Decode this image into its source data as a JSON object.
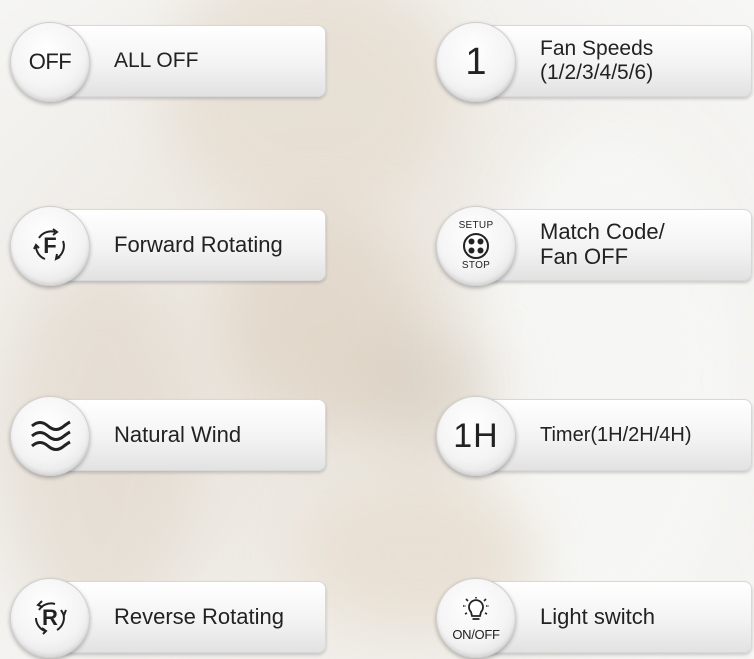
{
  "buttons": {
    "all_off": {
      "icon_text": "OFF",
      "label": "ALL OFF"
    },
    "fan_speed": {
      "icon_text": "1",
      "label": "Fan Speeds\n(1/2/3/4/5/6)"
    },
    "forward": {
      "icon_text": "F",
      "label": "Forward Rotating"
    },
    "match": {
      "icon_top": "SETUP",
      "icon_bottom": "STOP",
      "label": "Match Code/\nFan OFF"
    },
    "wind": {
      "icon": "wave-icon",
      "label": "Natural Wind"
    },
    "timer": {
      "icon_text": "1H",
      "label": "Timer(1H/2H/4H)"
    },
    "reverse": {
      "icon_text": "R",
      "label": "Reverse Rotating"
    },
    "light": {
      "icon_text": "ON/OFF",
      "label": "Light switch"
    }
  },
  "icons": {
    "forward": "rotate-arrows-icon",
    "match": "fan-icon",
    "light": "lightbulb-icon"
  }
}
